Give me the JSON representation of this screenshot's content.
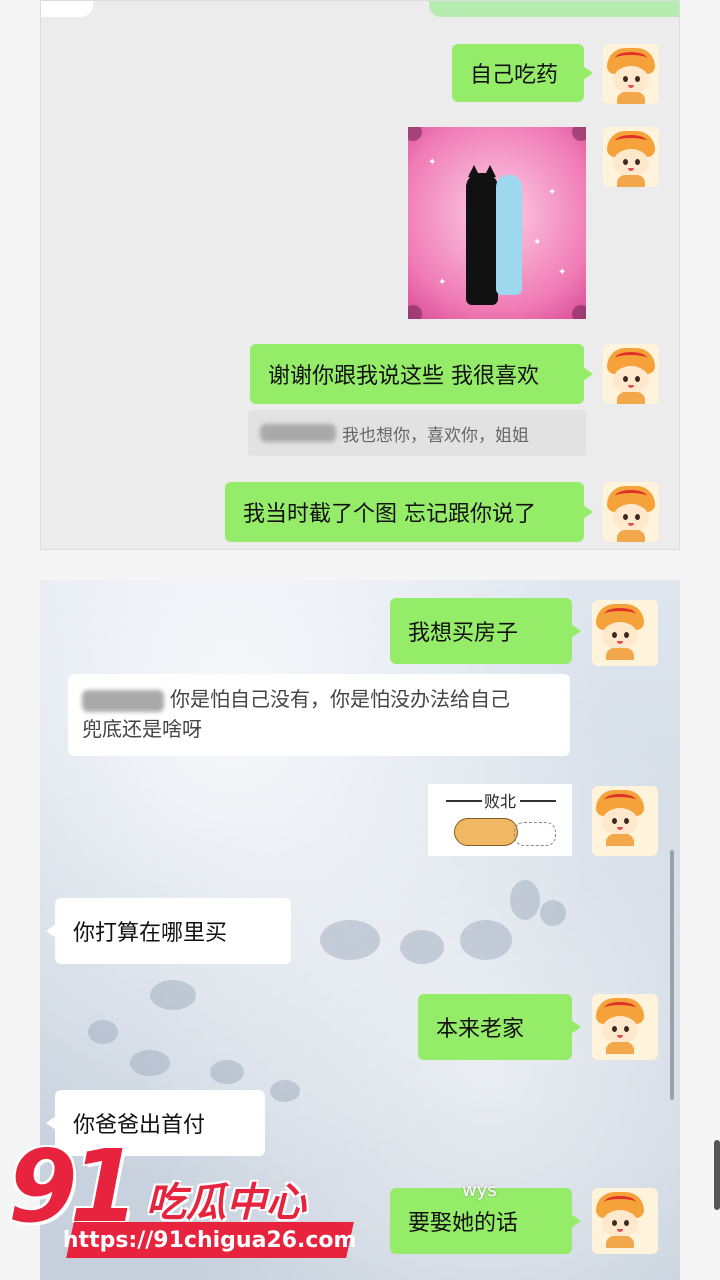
{
  "chat_top": {
    "messages": [
      {
        "text": "自己吃药"
      },
      {
        "text": "谢谢你跟我说这些 我很喜欢"
      },
      {
        "quote_text": "我也想你，喜欢你，姐姐"
      },
      {
        "text": "我当时截了个图 忘记跟你说了"
      }
    ]
  },
  "chat_bottom": {
    "messages": [
      {
        "text": "我想买房子"
      },
      {
        "reply_line1": "你是怕自己没有，你是怕没办法给自己",
        "reply_line2": "兜底还是啥呀"
      },
      {
        "sticker_text": "败北"
      },
      {
        "text": "你打算在哪里买"
      },
      {
        "text": "本来老家"
      },
      {
        "text": "你爸爸出首付"
      },
      {
        "text": "要娶她的话"
      }
    ]
  },
  "watermark": {
    "number": "91",
    "name": "吃瓜中心",
    "url": "https://91chigua26.com",
    "tag": "wys"
  },
  "colors": {
    "me_bubble": "#95ec69",
    "them_bubble": "#ffffff",
    "brand": "#e8233d"
  }
}
